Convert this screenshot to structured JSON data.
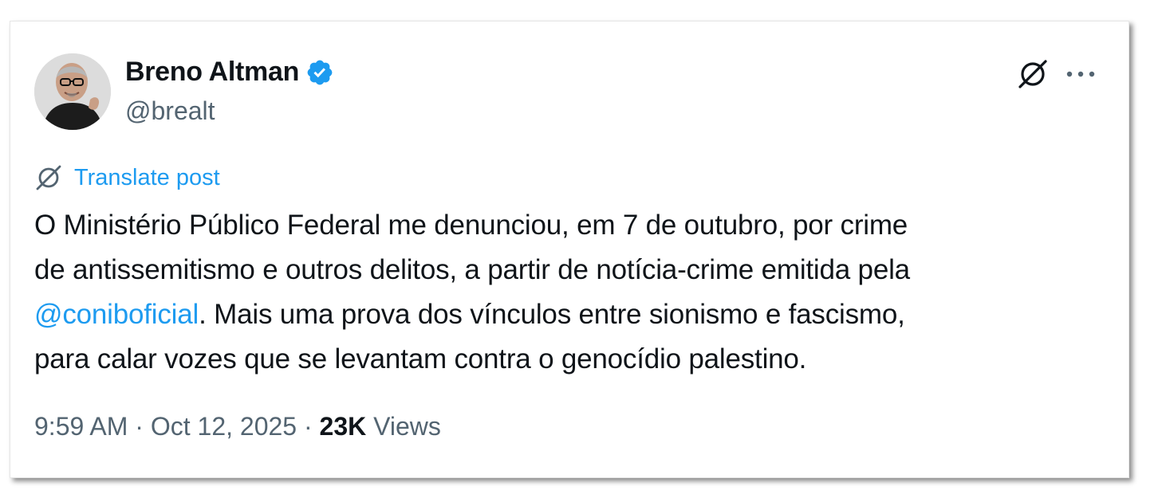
{
  "author": {
    "name": "Breno Altman",
    "handle": "@brealt",
    "verified": true,
    "avatar": "profile-photo"
  },
  "icons": {
    "verified": "verified-badge-icon",
    "translate": "translate-icon",
    "more": "more-horizontal-icon"
  },
  "colors": {
    "text": "#0f1419",
    "secondary": "#536471",
    "accent": "#1d9bf0"
  },
  "translate_label": "Translate post",
  "post": {
    "line1": "O Ministério Público Federal me denunciou, em 7 de outubro, por crime",
    "line2": "de antissemitismo e outros delitos, a partir de notícia-crime emitida pela",
    "mention": "@coniboficial",
    "line3_rest": ". Mais uma prova dos vínculos entre sionismo e fascismo,",
    "line4": "para calar vozes que se levantam contra o genocídio palestino."
  },
  "meta": {
    "time": "9:59 AM",
    "separator": " · ",
    "date": "Oct 12, 2025",
    "views_count": "23K",
    "views_label": "Views"
  }
}
